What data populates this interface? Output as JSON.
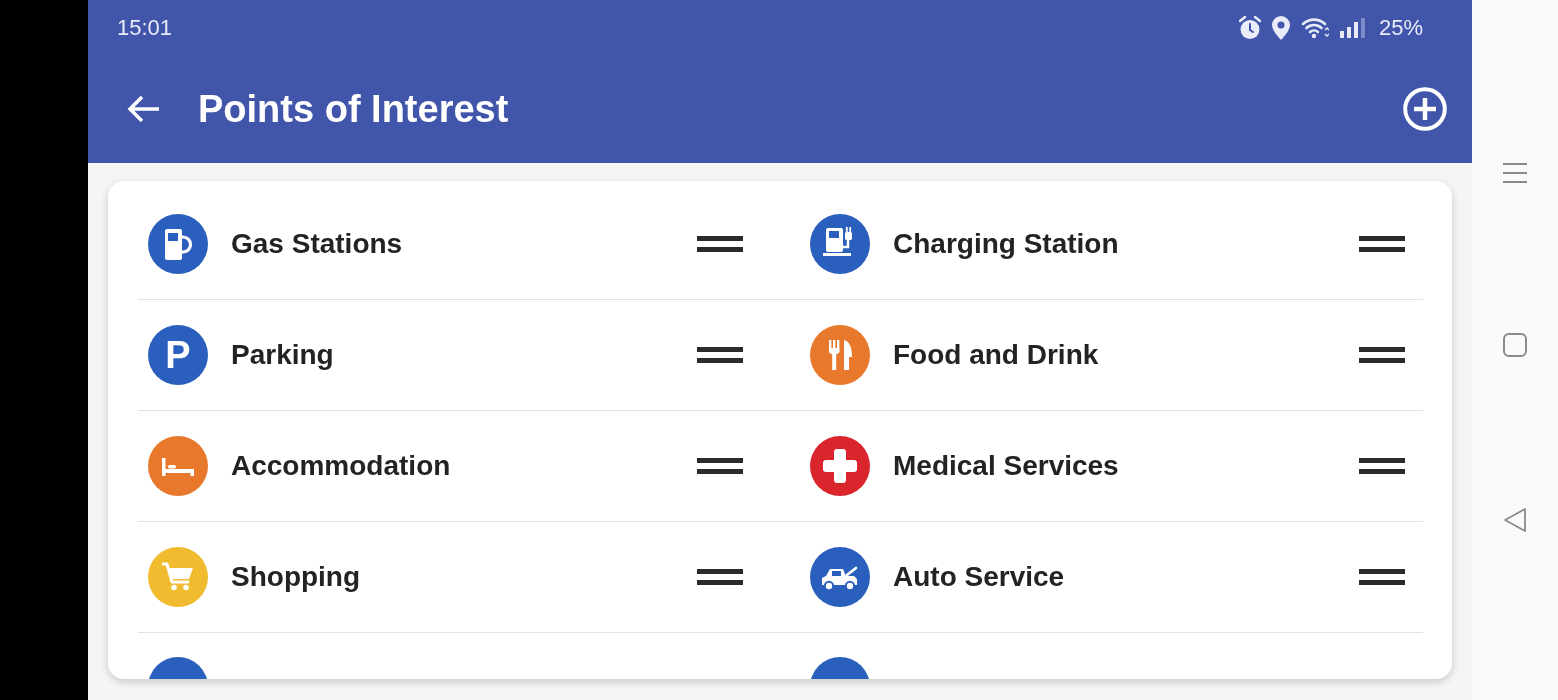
{
  "status_bar": {
    "time": "15:01",
    "battery": "25%"
  },
  "app_bar": {
    "title": "Points of Interest"
  },
  "poi_list": {
    "items": [
      {
        "label": "Gas Stations",
        "kind": "fuel",
        "color": "#2a5fbd"
      },
      {
        "label": "Charging Station",
        "kind": "charging",
        "color": "#2a5fbd"
      },
      {
        "label": "Parking",
        "kind": "parking",
        "glyph": "P",
        "color": "#2a5fbd"
      },
      {
        "label": "Food and Drink",
        "kind": "food",
        "color": "#e8792c"
      },
      {
        "label": "Accommodation",
        "kind": "bed",
        "color": "#e8792c"
      },
      {
        "label": "Medical Services",
        "kind": "medical",
        "color": "#d9252b"
      },
      {
        "label": "Shopping",
        "kind": "cart",
        "color": "#f0bb2e"
      },
      {
        "label": "Auto Service",
        "kind": "car",
        "color": "#2a5fbd"
      }
    ],
    "cut_off_items": [
      {
        "color": "#2a5fbd"
      },
      {
        "color": "#2a5fbd"
      }
    ]
  }
}
